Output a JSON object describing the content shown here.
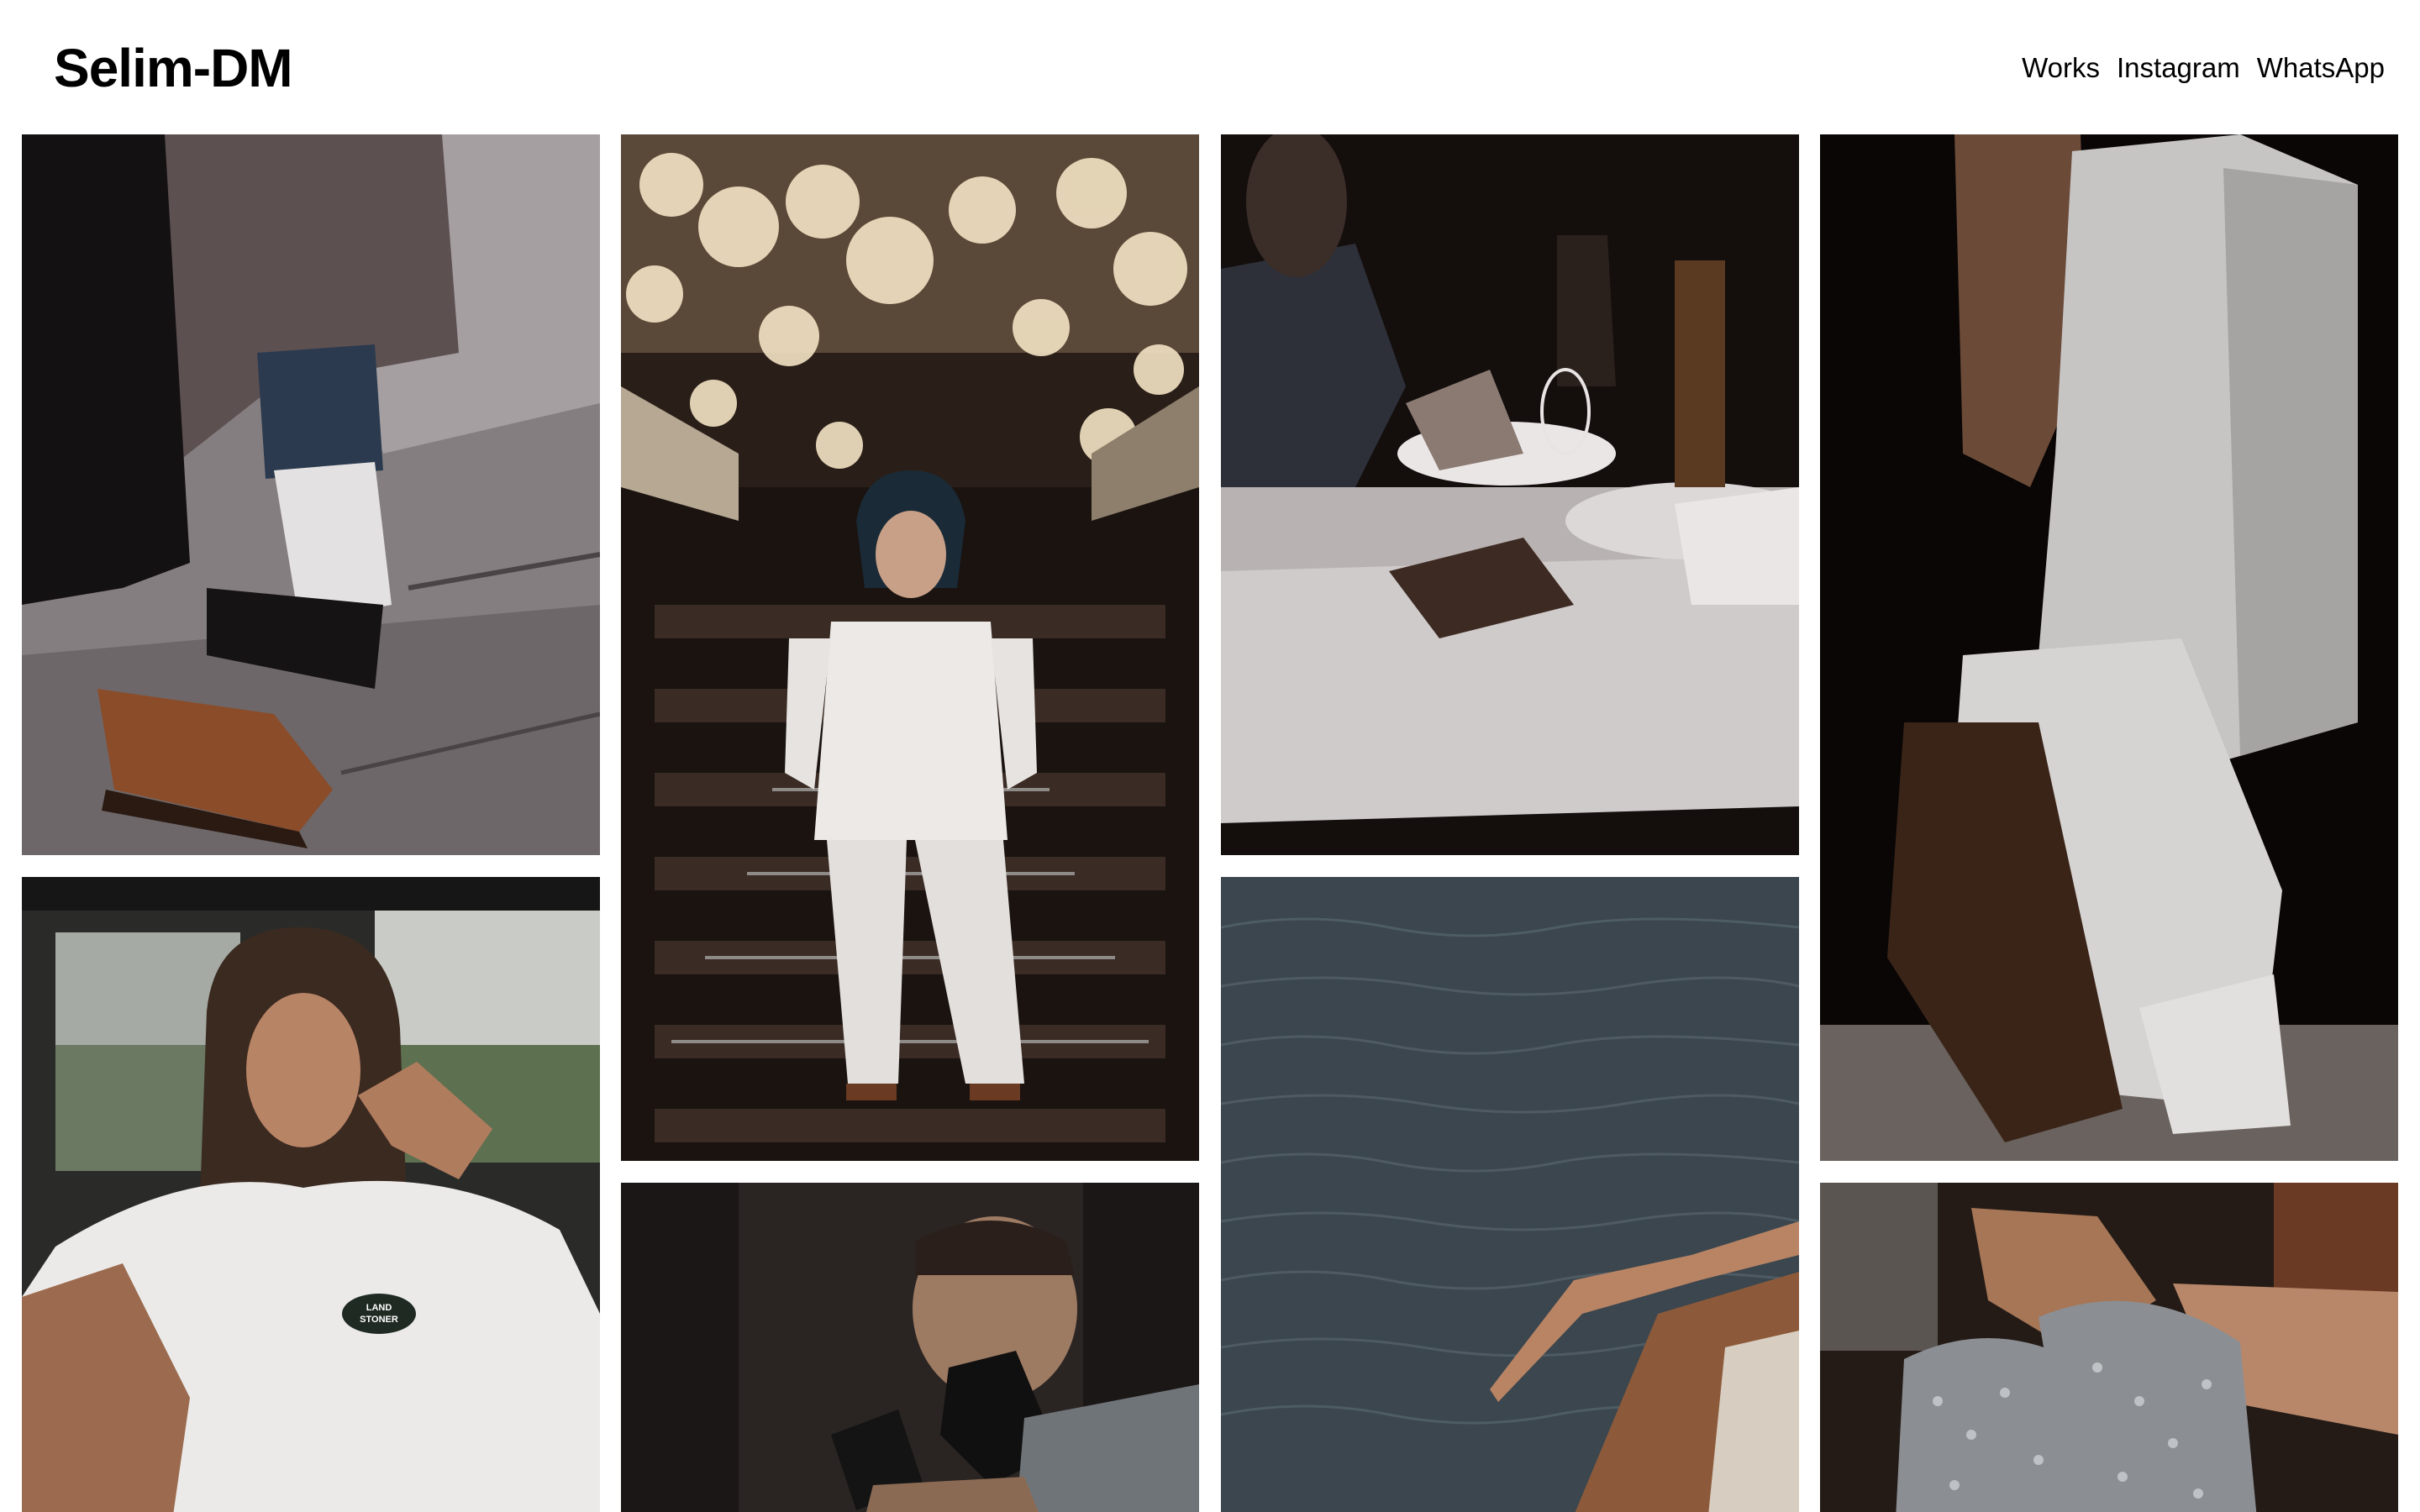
{
  "site": {
    "brand": "Selim-DM"
  },
  "nav": {
    "items": [
      "Works",
      "Instagram",
      "WhatsApp"
    ]
  },
  "gallery": {
    "tiles": [
      {
        "name": "photo-street-shoes"
      },
      {
        "name": "photo-staircase-white-suit"
      },
      {
        "name": "photo-dinner-table"
      },
      {
        "name": "photo-white-shirt-shorts"
      },
      {
        "name": "photo-car-tshirt"
      },
      {
        "name": "photo-boxer"
      },
      {
        "name": "photo-sea-hand"
      },
      {
        "name": "photo-sparkle-boots"
      }
    ],
    "tshirt_logo": [
      "LAND",
      "STONER"
    ]
  }
}
